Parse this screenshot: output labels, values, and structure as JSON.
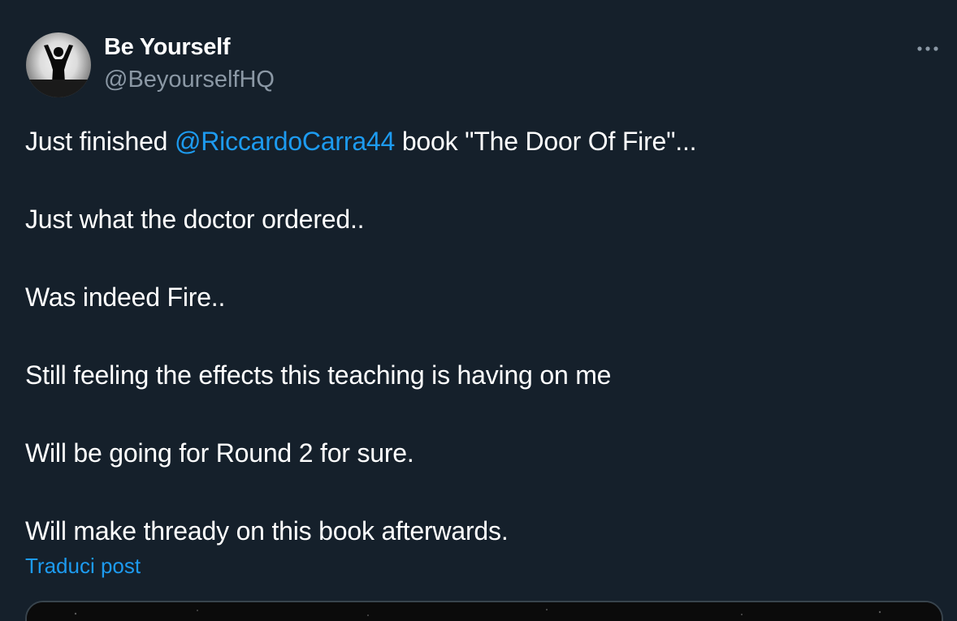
{
  "author": {
    "display_name": "Be Yourself",
    "handle": "@BeyourselfHQ"
  },
  "post": {
    "line1_before": "Just finished ",
    "line1_mention": "@RiccardoCarra44",
    "line1_after": " book \"The Door Of Fire\"...",
    "line2": "Just what the doctor ordered..",
    "line3": "Was indeed Fire..",
    "line4": "Still feeling the effects this teaching is having on me",
    "line5": "Will be going for Round 2 for sure.",
    "line6": "Will make thready on this book afterwards.",
    "translate_label": "Traduci post"
  },
  "icons": {
    "more": "more-horizontal-icon"
  },
  "colors": {
    "background": "#15202b",
    "accent": "#1d9bf0",
    "secondary_text": "#8b98a5",
    "primary_text": "#ffffff"
  }
}
